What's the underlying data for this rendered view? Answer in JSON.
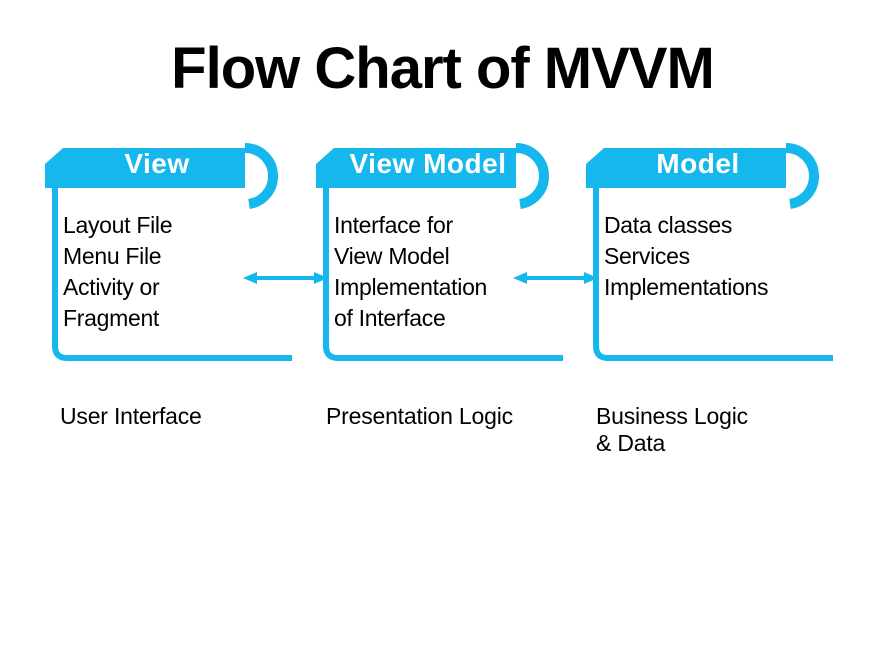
{
  "title": "Flow Chart of MVVM",
  "accent": "#16b7ec",
  "cards": {
    "view": {
      "header": "View",
      "body": "Layout File\nMenu File\nActivity or\nFragment",
      "caption": "User Interface"
    },
    "viewmodel": {
      "header": "View Model",
      "body": "Interface for\nView Model\nImplementation\nof Interface",
      "caption": "Presentation Logic"
    },
    "model": {
      "header": "Model",
      "body": "Data classes\nServices\nImplementations",
      "caption": "Business Logic\n& Data"
    }
  }
}
